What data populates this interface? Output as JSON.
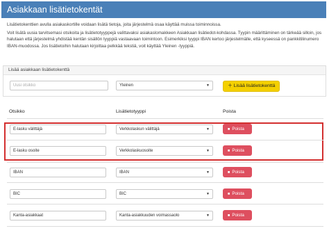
{
  "header": {
    "title": "Asiakkaan lisätietokentät"
  },
  "intro": {
    "paragraph1": "Lisätietokenttien avulla asiakaskortille voidaan lisätä tietoja, joita järjestelmä osaa käyttää muissa toiminnoissa.",
    "paragraph2": "Voit lisätä uusia tarvitsemasi otsikoita ja lisätietotyyppejä valittavaksi asiakaslomakkeen Asiakkaan lisätiedot-kohdassa. Tyypin määrittäminen on tärkeää silloin, jos halutaan että järjestelmä yhdistää kentän sisällön tyyppiä vastaavaan toimintoon. Esimerkiksi tyyppi IBAN kertoo järjestelmälle, että kyseessä on pankkitilinumero IBAN-muodossa. Jos lisätietoihin halutaan kirjoittaa pelkkää tekstiä, voit käyttää Yleinen -tyyppiä."
  },
  "add_panel": {
    "title": "Lisää asiakkaan lisätietokenttä",
    "title_placeholder": "Uusi otsikko",
    "type_value": "Yleinen",
    "add_button": "Lisää lisätietokenttä"
  },
  "table": {
    "headers": {
      "title": "Otsikko",
      "type": "Lisätietotyyppi",
      "remove": "Poista"
    },
    "rows": [
      {
        "title": "E-lasku välittäjä",
        "type": "Verkkolaskun välittäjä",
        "remove": "Poista"
      },
      {
        "title": "E-lasku osoite",
        "type": "Verkkolaskuosoite",
        "remove": "Poista"
      },
      {
        "title": "IBAN",
        "type": "IBAN",
        "remove": "Poista"
      },
      {
        "title": "BIC",
        "type": "BIC",
        "remove": "Poista"
      },
      {
        "title": "Kanta-asiakkaat",
        "type": "Kanta-asiakkuuden voimassaolo",
        "remove": "Poista"
      }
    ]
  },
  "colors": {
    "header": "#4a80b8",
    "add_button": "#f4d000",
    "delete_button": "#de4f5f",
    "highlight": "#d32f2f"
  },
  "icons": {
    "caret": "caret-down-icon",
    "plus": "plus-icon",
    "trash": "trash-icon"
  }
}
